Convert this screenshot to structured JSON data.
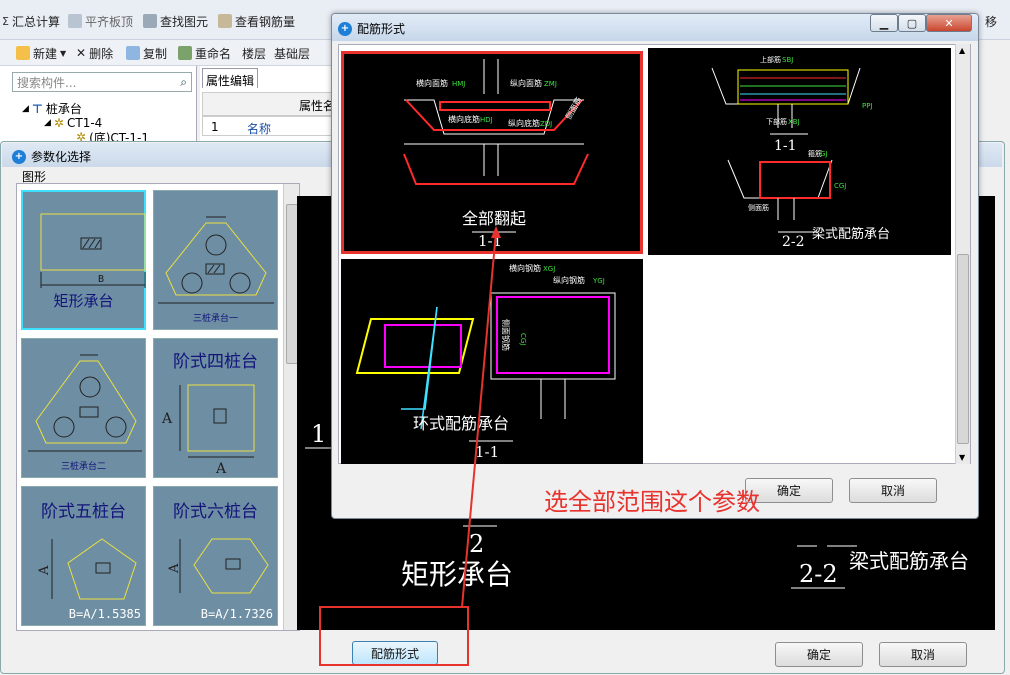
{
  "toolbar": {
    "items": [
      "汇总计算",
      "平齐板顶",
      "查找图元",
      "查看钢筋量"
    ],
    "row2": [
      "新建",
      "删除",
      "复制",
      "重命名",
      "楼层",
      "基础层"
    ],
    "right_fragment": "移"
  },
  "tree": {
    "search_placeholder": "搜索构件...",
    "root": "桩承台",
    "child": "CT1-4",
    "grandchild": "(底)CT-1-1"
  },
  "props": {
    "tab": "属性编辑",
    "header": "属性名",
    "row_num": "1",
    "row_name": "名称"
  },
  "param_window": {
    "title": "参数化选择",
    "group_label": "图形",
    "shapes": [
      {
        "label": "矩形承台",
        "dim": "B"
      },
      {
        "label": "三桩承台一"
      },
      {
        "label": "三桩承台二"
      },
      {
        "label": "阶式四桩台",
        "dim": "A"
      },
      {
        "label": "阶式五桩台",
        "formula": "B=A/1.5385",
        "dim": "A"
      },
      {
        "label": "阶式六桩台",
        "formula": "B=A/1.7326",
        "dim": "A"
      }
    ],
    "preview": {
      "section1": "1",
      "section2": "2",
      "title": "矩形承台",
      "sec22": "2-2",
      "beam_label": "梁式配筋承台"
    },
    "btn_rebar": "配筋形式",
    "btn_ok": "确定",
    "btn_cancel": "取消"
  },
  "rebar_dialog": {
    "title": "配筋形式",
    "options": [
      {
        "label": "全部翻起",
        "section": "1-1",
        "selected": true
      },
      {
        "label": "梁式配筋承台",
        "section": "2-2",
        "section_top": "1-1"
      },
      {
        "label": "环式配筋承台",
        "section": "1-1"
      }
    ],
    "cad_text": {
      "hgj": "横向面筋",
      "hgj_code": "HMJ",
      "zgj": "纵向面筋",
      "zgj_code": "ZMJ",
      "hdj": "横向底筋",
      "hdj_code": "HDJ",
      "zdj": "纵向底筋",
      "zdj_code": "ZDJ",
      "cmj": "侧面筋",
      "ring_h": "横向钢筋",
      "ring_h_code": "XGJ",
      "ring_z": "纵向钢筋",
      "ring_z_code": "YGJ",
      "ring_side": "侧面钢筋",
      "ring_side_code": "CGJ",
      "top_bar": "上部筋",
      "top_code": "SBJ",
      "bot_bar": "下部筋",
      "bot_code": "XBJ",
      "gu": "箍筋",
      "gu_code": "GJ",
      "side": "侧面筋",
      "side_code": "CGJ",
      "pjj": "PPJ"
    },
    "btn_ok": "确定",
    "btn_cancel": "取消"
  },
  "annotation": {
    "text": "选全部范围这个参数",
    "color": "#e8322d"
  },
  "colors": {
    "highlight": "#e8322d",
    "cad_bg": "#000000",
    "cad_red": "#ff2a2a",
    "cad_magenta": "#ff00ff",
    "cad_yellow": "#ffff00",
    "cad_cyan": "#00ffff",
    "selection": "#3ee0ff"
  }
}
